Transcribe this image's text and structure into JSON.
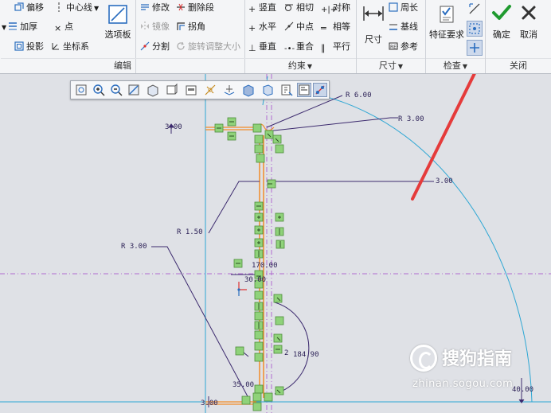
{
  "ribbon": {
    "group_edit": {
      "items": {
        "offset": "偏移",
        "centerline": "中心线",
        "thicken": "加厚",
        "point": "点",
        "project": "投影",
        "coord_sys": "坐标系",
        "palette": "选项板",
        "modify": "修改",
        "delete_segment": "删除段",
        "mirror": "镜像",
        "corner": "拐角",
        "divide": "分割",
        "rotate_resize": "旋转调整大小"
      },
      "label": "编辑"
    },
    "group_constraint": {
      "items": {
        "vertical": "竖直",
        "tangent": "相切",
        "symmetric": "对称",
        "horizontal": "水平",
        "midpoint": "中点",
        "equal": "相等",
        "perpendicular": "垂直",
        "coincident": "重合",
        "parallel": "平行"
      },
      "label": "约束"
    },
    "group_dimension": {
      "items": {
        "dimension": "尺寸",
        "perimeter": "周长",
        "baseline": "基线",
        "reference": "参考"
      },
      "label": "尺寸"
    },
    "group_inspect": {
      "items": {
        "feature_requirements": "特征要求"
      },
      "label": "检查"
    },
    "group_close": {
      "items": {
        "ok": "确定",
        "cancel": "取消"
      },
      "label": "关闭"
    }
  },
  "dimensions": {
    "r600": "R 6.00",
    "r300_top": "R 3.00",
    "d300_left": "3.00",
    "d300_arc": "3.00",
    "r150": "R 1.50",
    "r300_left": "R 3.00",
    "d17000": "170.00",
    "d3000": "30.00",
    "d18490": "184.90",
    "d3500": "35.00",
    "d300_bottom": "3.00",
    "d2": "2",
    "d4000": "40.00"
  },
  "watermark": {
    "brand": "搜狗指南",
    "url": "zhinan.sogou.com"
  },
  "colors": {
    "ok_green": "#1f9a2f",
    "cancel_dark": "#333333",
    "arrow_red": "#e53b3b",
    "sketch_cyan": "#2ea7d4",
    "centerline_purple": "#b06ad0",
    "dim_navy": "#2a1f55",
    "geometry_orange": "#f28c28",
    "constraint_green": "#8fd27a"
  }
}
